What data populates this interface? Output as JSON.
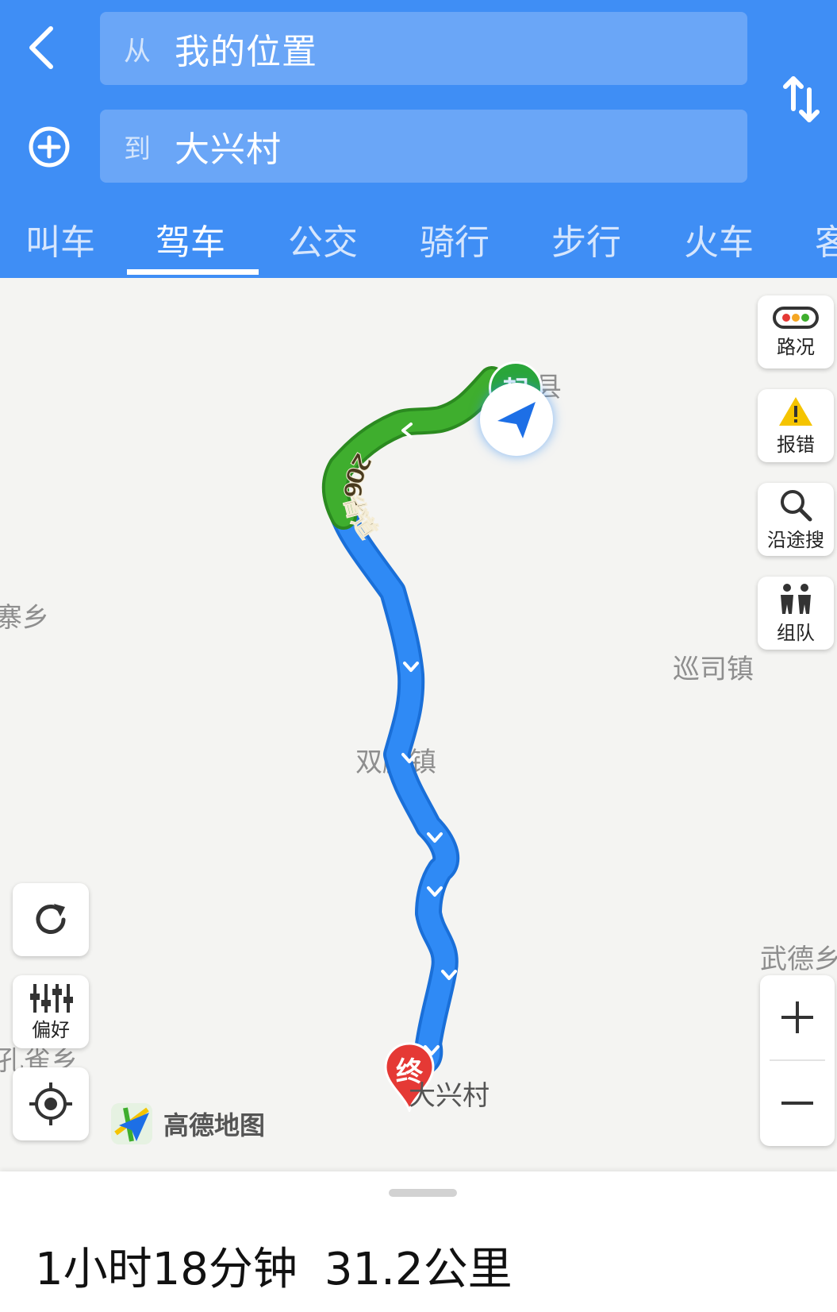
{
  "header": {
    "from_prefix": "从",
    "from_value": "我的位置",
    "to_prefix": "到",
    "to_value": "大兴村"
  },
  "tabs": [
    {
      "label": "叫车",
      "active": false
    },
    {
      "label": "驾车",
      "active": true
    },
    {
      "label": "公交",
      "active": false
    },
    {
      "label": "骑行",
      "active": false
    },
    {
      "label": "步行",
      "active": false
    },
    {
      "label": "火车",
      "active": false
    },
    {
      "label": "客",
      "active": false
    }
  ],
  "map": {
    "places": {
      "county": "筠连县",
      "village_left": "寨乡",
      "xunsi": "巡司镇",
      "shuangteng": "双腾镇",
      "wude": "武德乡",
      "kongque": "孔雀乡",
      "dest": "大兴村"
    },
    "road_label": "206省道",
    "start_marker": "起",
    "end_marker": "终",
    "logo_text": "高德地图"
  },
  "side_buttons": {
    "traffic": "路况",
    "report": "报错",
    "search_along": "沿途搜",
    "team": "组队"
  },
  "left_buttons": {
    "preference": "偏好"
  },
  "summary": {
    "duration": "1小时18分钟",
    "distance": "31.2公里"
  },
  "colors": {
    "header_bg": "#3f8ef5",
    "route_blue": "#2f8af5",
    "route_green": "#3fae2e",
    "start_green": "#2aa63a",
    "end_red": "#e53935"
  }
}
